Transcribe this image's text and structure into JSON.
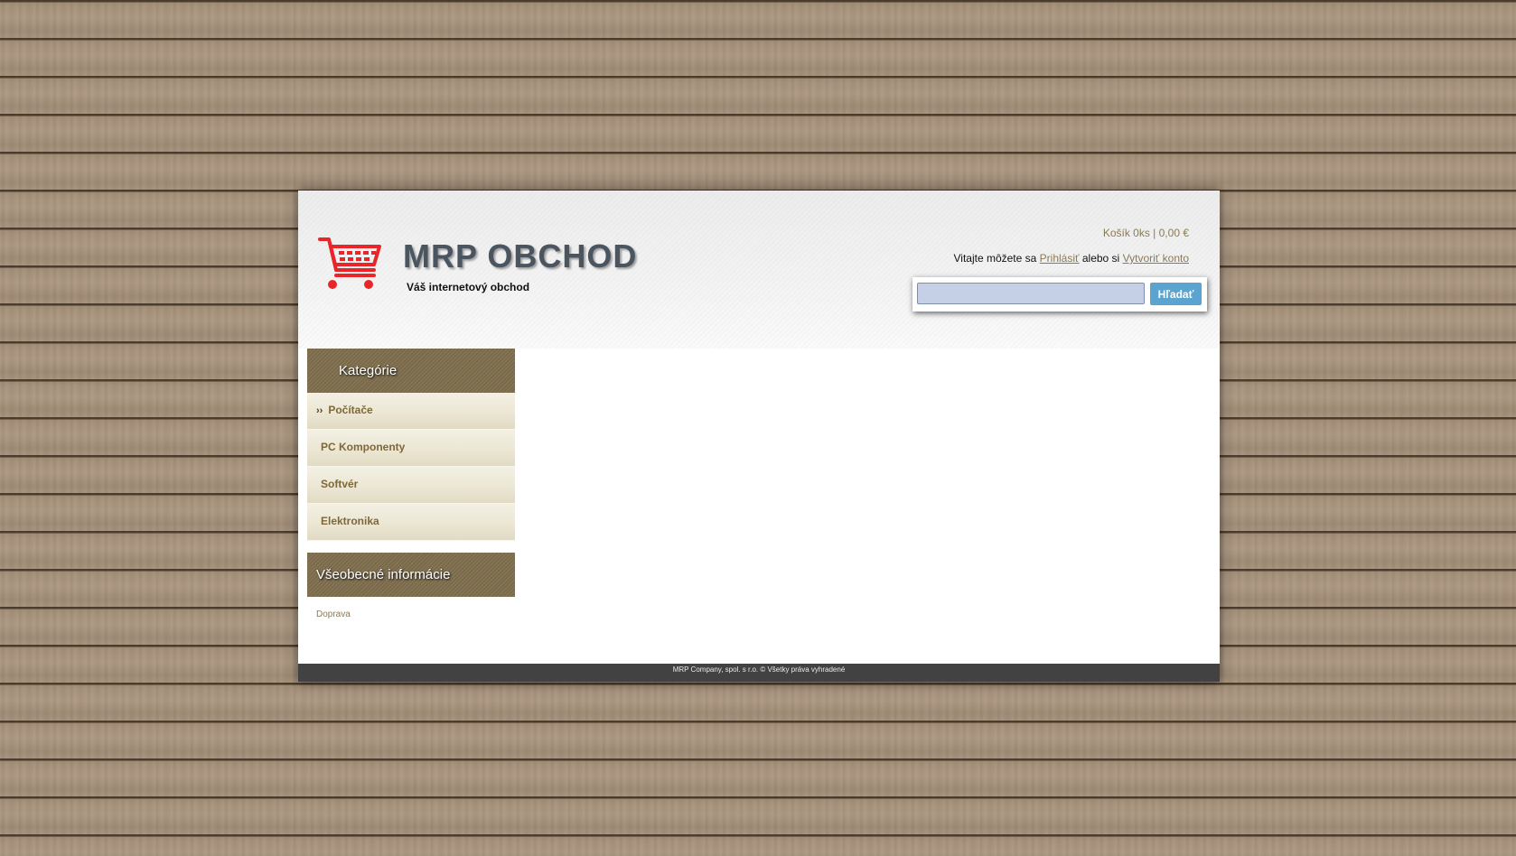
{
  "header": {
    "title": "MRP OBCHOD",
    "subtitle": "Váš internetový obchod",
    "cart": "Košík 0ks | 0,00 €",
    "welcome_prefix": "Vitajte môžete sa",
    "login_link": "Prihlásiť",
    "welcome_middle": "alebo si",
    "register_link": "Vytvoriť konto",
    "logo_icon": "shopping-cart-icon",
    "logo_color": "#e8262a"
  },
  "search": {
    "placeholder": "",
    "value": "",
    "button_label": "Hľadať"
  },
  "sidebar": {
    "categories_title": "Kategórie",
    "active_marker": "››",
    "categories": [
      {
        "label": "Počítače",
        "active": true
      },
      {
        "label": "PC Komponenty",
        "active": false
      },
      {
        "label": "Softvér",
        "active": false
      },
      {
        "label": "Elektronika",
        "active": false
      }
    ],
    "info_title": "Všeobecné informácie",
    "info_links": [
      "Doprava"
    ]
  },
  "footer": {
    "text": "MRP Company, spol. s r.o. © Všetky práva vyhradené"
  }
}
